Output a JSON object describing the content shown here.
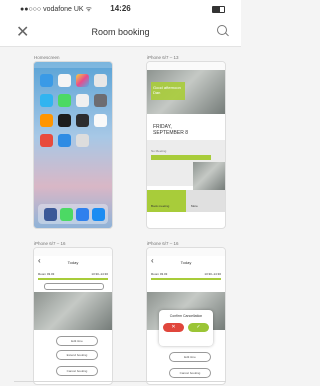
{
  "status_bar": {
    "carrier": "●●○○○ vodafone UK ᯤ",
    "time": "14:26"
  },
  "navbar": {
    "title": "Room booking",
    "close_icon": "close-icon",
    "search_icon": "search-icon"
  },
  "thumbnails": [
    {
      "label": "Homescreen"
    },
    {
      "label": "iPhone 6/7 – 13",
      "greeting": "Good afternoon Dan",
      "date_line1": "FRIDAY,",
      "date_line2": "SEPTEMBER 8",
      "section": "No Meeting",
      "action1": "Book meeting",
      "action2": "More"
    },
    {
      "label": "iPhone 6/7 – 16",
      "header": "Today",
      "room": "Room 03.03",
      "time": "13:30–14:30",
      "btn1": "Edit time",
      "btn2": "Extend booking",
      "btn3": "Cancel booking"
    },
    {
      "label": "iPhone 6/7 – 16",
      "header": "Today",
      "room": "Room 03.03",
      "time": "13:30–14:30",
      "dialog": "Confirm Cancellation",
      "btn1": "Edit time",
      "btn3": "Cancel booking"
    }
  ],
  "colors": {
    "accent": "#a8cc3a",
    "confirm_red": "#e0463c",
    "confirm_green": "#9bc536"
  }
}
